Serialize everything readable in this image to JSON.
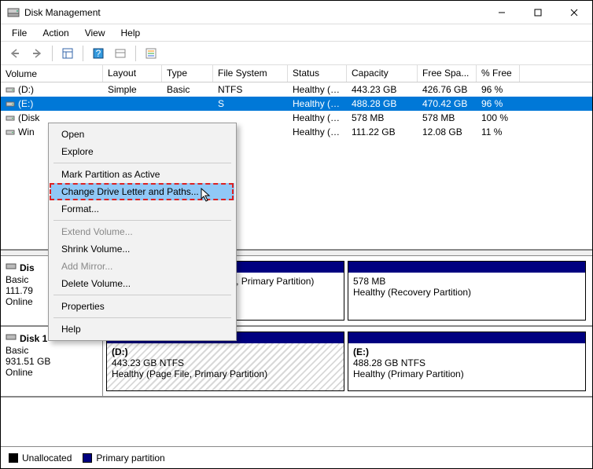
{
  "window": {
    "title": "Disk Management"
  },
  "menubar": [
    "File",
    "Action",
    "View",
    "Help"
  ],
  "table": {
    "headers": [
      "Volume",
      "Layout",
      "Type",
      "File System",
      "Status",
      "Capacity",
      "Free Spa...",
      "% Free"
    ],
    "rows": [
      {
        "vol": "(D:)",
        "lay": "Simple",
        "typ": "Basic",
        "fs": "NTFS",
        "st": "Healthy (P...",
        "cap": "443.23 GB",
        "free": "426.76 GB",
        "pf": "96 %",
        "selected": false
      },
      {
        "vol": "(E:)",
        "lay": "",
        "typ": "",
        "fs": "S",
        "st": "Healthy (P...",
        "cap": "488.28 GB",
        "free": "470.42 GB",
        "pf": "96 %",
        "selected": true
      },
      {
        "vol": "(Disk",
        "lay": "",
        "typ": "",
        "fs": "",
        "st": "Healthy (R...",
        "cap": "578 MB",
        "free": "578 MB",
        "pf": "100 %",
        "selected": false
      },
      {
        "vol": "Win",
        "lay": "",
        "typ": "",
        "fs": "",
        "st": "Healthy (S...",
        "cap": "111.22 GB",
        "free": "12.08 GB",
        "pf": "11 %",
        "selected": false
      }
    ]
  },
  "context_menu": {
    "items": [
      {
        "label": "Open",
        "enabled": true
      },
      {
        "label": "Explore",
        "enabled": true
      },
      {
        "sep": true
      },
      {
        "label": "Mark Partition as Active",
        "enabled": true
      },
      {
        "label": "Change Drive Letter and Paths...",
        "enabled": true,
        "highlight": true
      },
      {
        "label": "Format...",
        "enabled": true
      },
      {
        "sep": true
      },
      {
        "label": "Extend Volume...",
        "enabled": false
      },
      {
        "label": "Shrink Volume...",
        "enabled": true
      },
      {
        "label": "Add Mirror...",
        "enabled": false
      },
      {
        "label": "Delete Volume...",
        "enabled": true
      },
      {
        "sep": true
      },
      {
        "label": "Properties",
        "enabled": true
      },
      {
        "sep": true
      },
      {
        "label": "Help",
        "enabled": true
      }
    ]
  },
  "disks": [
    {
      "name": "Dis",
      "type": "Basic",
      "size": "111.79",
      "status": "Online",
      "parts": [
        {
          "label": "",
          "line2": "",
          "line3": "Healthy (System, Boot, Active, Primary Partition)",
          "hatched": false
        },
        {
          "label": "",
          "line2": "578 MB",
          "line3": "Healthy (Recovery Partition)",
          "hatched": false
        }
      ]
    },
    {
      "name": "Disk 1",
      "type": "Basic",
      "size": "931.51 GB",
      "status": "Online",
      "parts": [
        {
          "label": "(D:)",
          "line2": "443.23 GB NTFS",
          "line3": "Healthy (Page File, Primary Partition)",
          "hatched": true
        },
        {
          "label": "(E:)",
          "line2": "488.28 GB NTFS",
          "line3": "Healthy (Primary Partition)",
          "hatched": false
        }
      ]
    }
  ],
  "legend": {
    "unallocated": "Unallocated",
    "primary": "Primary partition"
  }
}
